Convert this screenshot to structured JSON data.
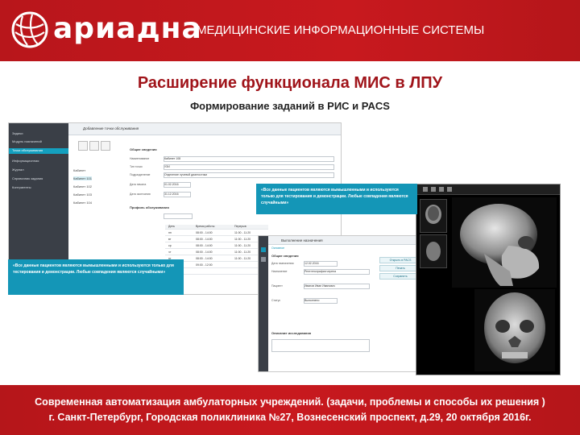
{
  "brand": {
    "logo_text": "ариадна",
    "logo_icon": "globe-grid-icon"
  },
  "header": {
    "subtitle": "МЕДИЦИНСКИЕ ИНФОРМАЦИОННЫЕ СИСТЕМЫ"
  },
  "title": "Расширение функционала МИС в ЛПУ",
  "subtitle": "Формирование заданий в РИС и PACS",
  "disclaimer": "«Все данные пациентов являются вымышленными и используются только для тестирования и демонстрации. Любые совпадения являются случайными»",
  "screen1": {
    "window_title": "Добавление точки обслуживания",
    "sidebar_items": [
      "Задачи",
      "Модуль назначений",
      "Точки обслуживания",
      "Информационная",
      "Журнал",
      "Справочник задания",
      "Контрагенты"
    ],
    "tree_items": [
      "Кабинет",
      "Кабинет 101",
      "Кабинет 102",
      "Кабинет 103",
      "Кабинет 104"
    ],
    "section_general": "Общие сведения",
    "fields": [
      {
        "label": "Наименование",
        "value": "Кабинет 108"
      },
      {
        "label": "Тип точки",
        "value": "УЗИ"
      },
      {
        "label": "Подразделение",
        "value": "Отделение лучевой диагностики"
      },
      {
        "label": "Дата начала",
        "value": "01.02.2016"
      },
      {
        "label": "Дата окончания",
        "value": "31.12.2016"
      }
    ],
    "section_schedule": "Профиль обслуживания",
    "schedule_columns": [
      "День",
      "Время работы",
      "Перерыв"
    ],
    "schedule_rows": [
      [
        "пн",
        "08:00 - 14:00",
        "11:00 - 11:20"
      ],
      [
        "вт",
        "08:00 - 14:00",
        "11:00 - 11:20"
      ],
      [
        "ср",
        "08:00 - 14:00",
        "11:00 - 11:20"
      ],
      [
        "чт",
        "08:00 - 14:00",
        "11:00 - 11:20"
      ],
      [
        "пт",
        "08:00 - 14:00",
        "11:00 - 11:20"
      ],
      [
        "сб",
        "09:00 - 12:00",
        ""
      ],
      [
        "вс",
        "",
        ""
      ]
    ]
  },
  "screen2": {
    "window_title": "Выполнение назначения",
    "tab": "Основное",
    "section": "Общие сведения",
    "fields": [
      {
        "label": "Дата назначения",
        "value": "12.02.2016"
      },
      {
        "label": "Назначение",
        "value": "Рентгенография черепа"
      },
      {
        "label": "Пациент",
        "value": "Иванов Иван Иванович"
      },
      {
        "label": "Статус",
        "value": "Выполнено"
      }
    ],
    "section2": "Описание исследования",
    "buttons": [
      "Открыть в PACS",
      "Печать",
      "Сохранить"
    ]
  },
  "colors": {
    "brand_red": "#c8191e",
    "teal": "#1496b7",
    "sidebar": "#3a3f47"
  },
  "footer": {
    "line1": "Современная автоматизация амбулаторных учреждений. (задачи, проблемы и способы их решения )",
    "line2": "г. Санкт-Петербург, Городская поликлиника №27, Вознесенский проспект, д.29, 20 октября 2016г."
  }
}
